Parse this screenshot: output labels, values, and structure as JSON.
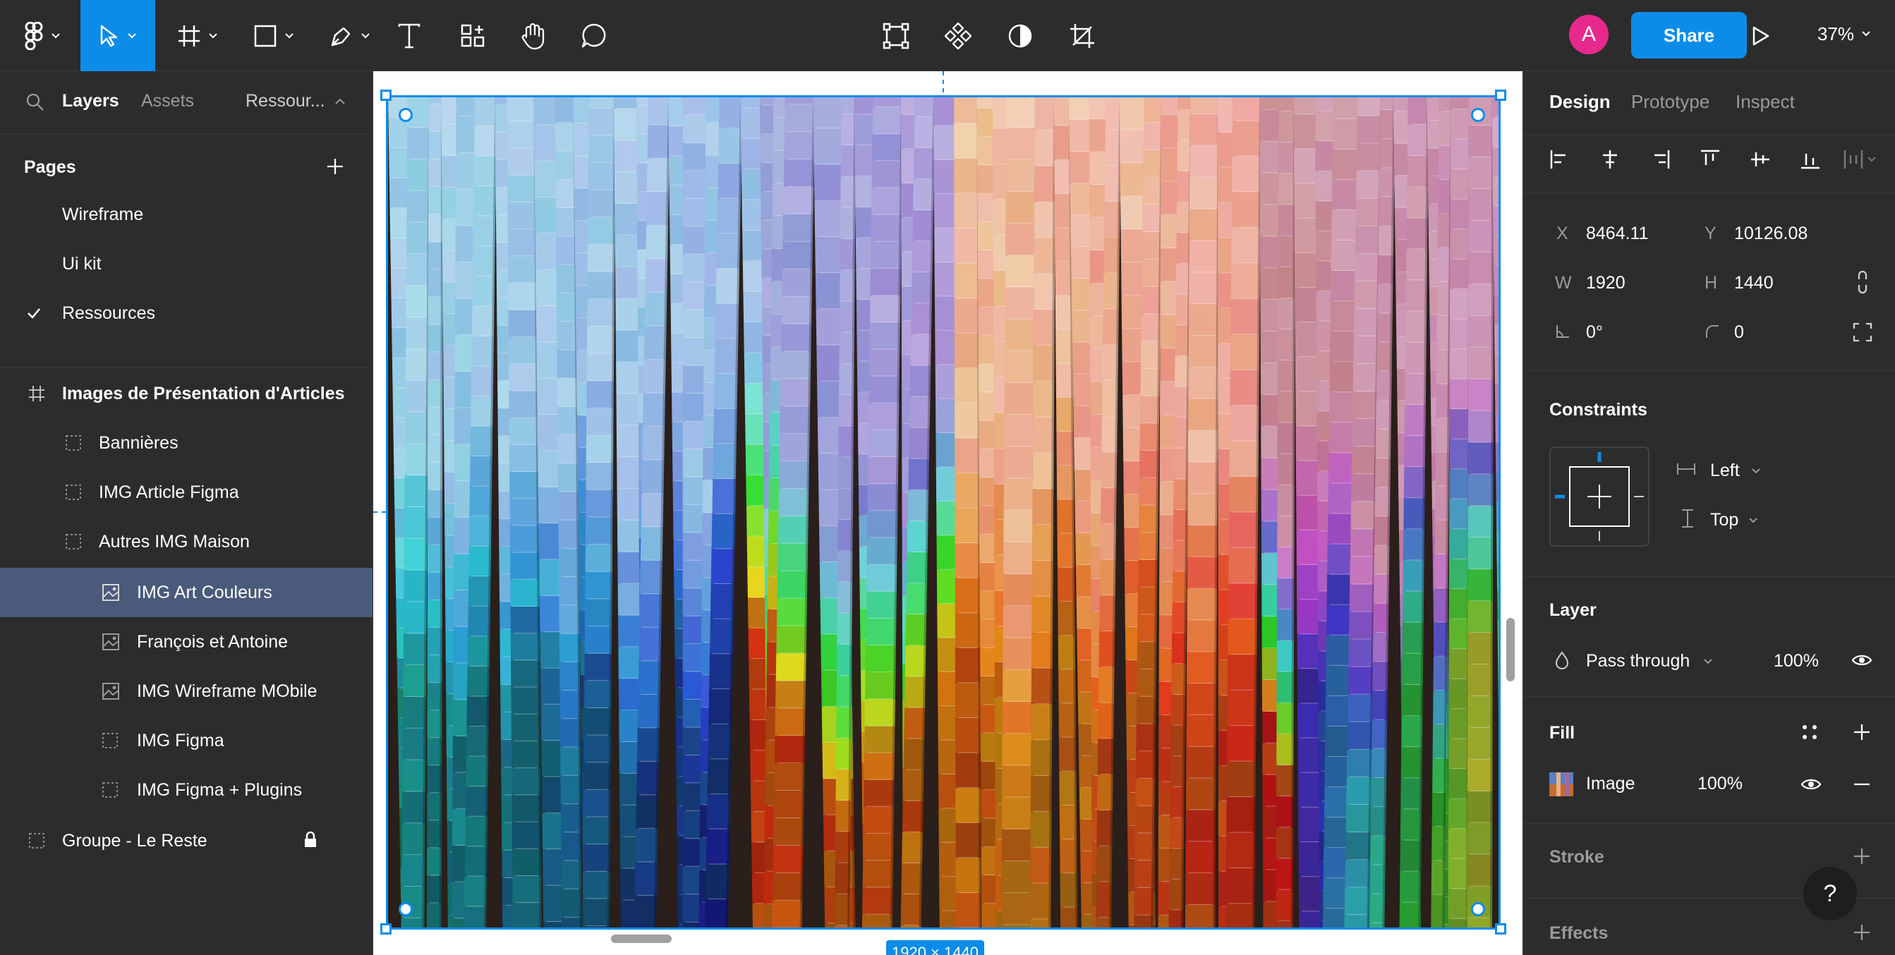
{
  "toolbar": {
    "zoom": "37%",
    "share_label": "Share",
    "avatar_initial": "A",
    "accent": "#0c8ce9"
  },
  "left_panel": {
    "tabs": [
      "Layers",
      "Assets",
      "Ressour..."
    ],
    "pages_title": "Pages",
    "pages": [
      {
        "label": "Wireframe",
        "checked": false
      },
      {
        "label": "Ui kit",
        "checked": false
      },
      {
        "label": "Ressources",
        "checked": true
      }
    ],
    "layers": [
      {
        "label": "Images de Présentation d'Articles",
        "icon": "frame-icon",
        "indent": 0,
        "bold": true
      },
      {
        "label": "Bannières",
        "icon": "section-icon",
        "indent": 1
      },
      {
        "label": "IMG Article Figma",
        "icon": "section-icon",
        "indent": 1
      },
      {
        "label": "Autres IMG Maison",
        "icon": "section-icon",
        "indent": 1
      },
      {
        "label": "IMG Art Couleurs",
        "icon": "image-icon",
        "indent": 2,
        "selected": true
      },
      {
        "label": "François et Antoine",
        "icon": "image-icon",
        "indent": 2
      },
      {
        "label": "IMG Wireframe MObile",
        "icon": "image-icon",
        "indent": 2
      },
      {
        "label": "IMG Figma",
        "icon": "section-icon",
        "indent": 2
      },
      {
        "label": "IMG Figma + Plugins",
        "icon": "section-icon",
        "indent": 2
      },
      {
        "label": "Groupe - Le Reste",
        "icon": "section-icon",
        "indent": 0,
        "locked": true
      }
    ]
  },
  "canvas": {
    "size_label": "1920 × 1440"
  },
  "right_panel": {
    "tabs": [
      "Design",
      "Prototype",
      "Inspect"
    ],
    "x_label": "X",
    "x_value": "8464.11",
    "y_label": "Y",
    "y_value": "10126.08",
    "w_label": "W",
    "w_value": "1920",
    "h_label": "H",
    "h_value": "1440",
    "rotation": "0°",
    "corner_radius": "0",
    "constraints_title": "Constraints",
    "constraint_h": "Left",
    "constraint_v": "Top",
    "layer_title": "Layer",
    "blend_mode": "Pass through",
    "layer_opacity": "100%",
    "fill_title": "Fill",
    "fill_type": "Image",
    "fill_opacity": "100%",
    "stroke_title": "Stroke",
    "effects_title": "Effects",
    "help": "?"
  }
}
